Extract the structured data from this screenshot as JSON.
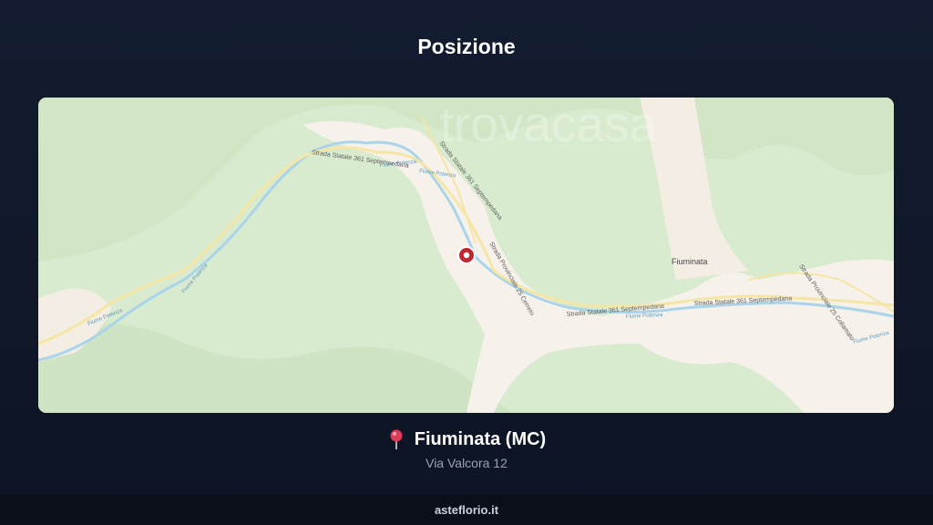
{
  "page": {
    "title": "Posizione"
  },
  "map": {
    "watermark": "trovacasa",
    "town_label": "Fiuminata",
    "road_labels": [
      "Strada Statale 361 Septempedana",
      "Strada Statale 361 Septempedana",
      "Strada Statale 361 Septempedana",
      "Strada Statale 361 Septempedana",
      "Strada Provinciale 25 Cerreto",
      "Strada Provinciale 25 Collamato"
    ],
    "river_labels": [
      "Fiume Potenza",
      "Fiume Potenza",
      "Fiume Potenza",
      "Fiume Potenza",
      "Fiume Potenza",
      "Fiume Potenza"
    ],
    "marker_icon": "location-marker-icon",
    "colors": {
      "land": "#d9ebcf",
      "urban": "#f6f1ea",
      "road": "#f5e6a6",
      "river": "#a9d4ea",
      "marker": "#c0262f"
    }
  },
  "location": {
    "pin_icon": "pin-icon",
    "name": "Fiuminata (MC)",
    "address": "Via Valcora 12"
  },
  "footer": {
    "brand": "asteflorio.it"
  }
}
